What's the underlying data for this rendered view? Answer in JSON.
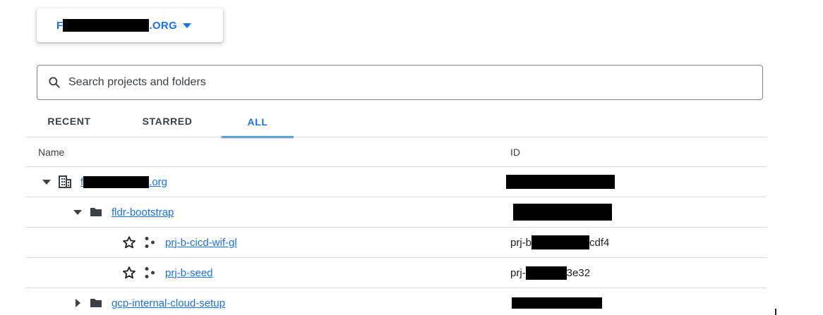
{
  "org_selector": {
    "prefix": "F",
    "suffix": ".ORG"
  },
  "search": {
    "placeholder": "Search projects and folders"
  },
  "tabs": [
    {
      "label": "RECENT",
      "selected": false
    },
    {
      "label": "STARRED",
      "selected": false
    },
    {
      "label": "ALL",
      "selected": true
    }
  ],
  "table": {
    "headers": {
      "name": "Name",
      "id": "ID"
    },
    "rows": [
      {
        "type": "organization",
        "expanded": true,
        "name_prefix": "f",
        "name_suffix": ".org",
        "id_prefix": "",
        "id_suffix": ""
      },
      {
        "type": "folder",
        "expanded": true,
        "name": "fldr-bootstrap",
        "id_prefix": "",
        "id_suffix": ""
      },
      {
        "type": "project",
        "name": "prj-b-cicd-wif-gl",
        "id_prefix": "prj-b",
        "id_suffix": "cdf4"
      },
      {
        "type": "project",
        "name": "prj-b-seed",
        "id_prefix": "prj-",
        "id_suffix": "3e32"
      },
      {
        "type": "folder",
        "expanded": false,
        "name": "gcp-internal-cloud-setup",
        "id_prefix": "",
        "id_suffix": ""
      }
    ]
  },
  "colors": {
    "accent": "#1a73e8",
    "text": "#202124",
    "divider": "#dadce0"
  }
}
